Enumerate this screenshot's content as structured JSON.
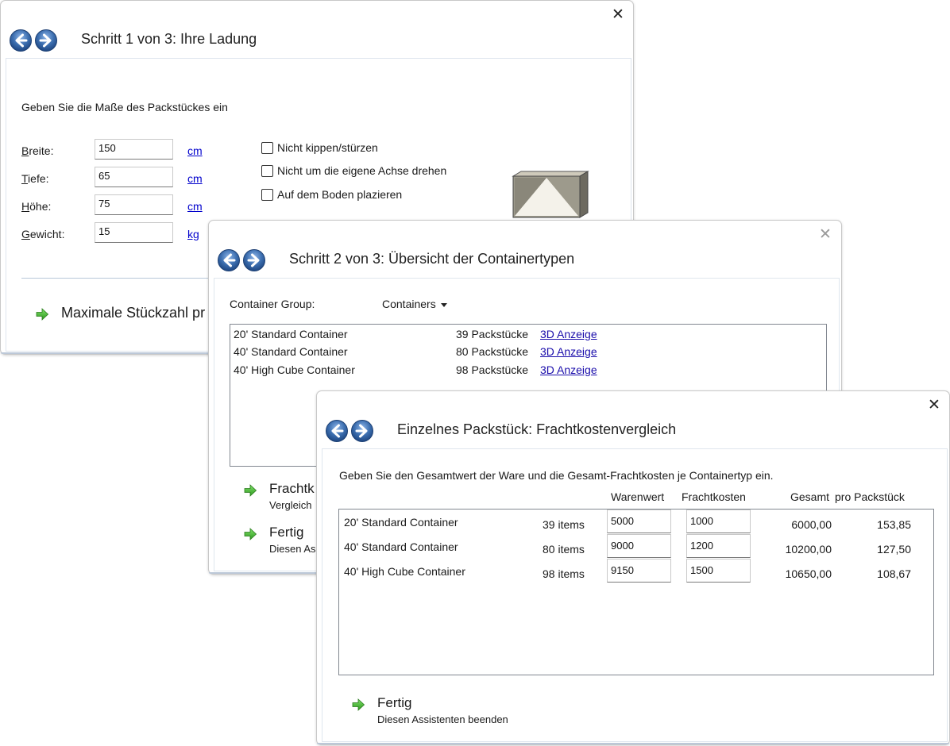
{
  "window1": {
    "title": "Schritt 1 von 3: Ihre Ladung",
    "instruction": "Geben Sie die Maße des Packstückes ein",
    "fields": [
      {
        "label": "Breite:",
        "value": "150",
        "unit": "cm"
      },
      {
        "label": "Tiefe:",
        "value": "65",
        "unit": "cm"
      },
      {
        "label": "Höhe:",
        "value": "75",
        "unit": "cm"
      },
      {
        "label": "Gewicht:",
        "value": "15",
        "unit": "kg"
      }
    ],
    "options": [
      "Nicht kippen/stürzen",
      "Nicht um die eigene Achse drehen",
      "Auf dem Boden plazieren"
    ],
    "action_label": "Maximale Stückzahl pr"
  },
  "window2": {
    "title": "Schritt 2 von 3: Übersicht der Containertypen",
    "group_label": "Container Group:",
    "group_value": "Containers",
    "rows": [
      {
        "name": "20' Standard Container",
        "count": "39 Packstücke",
        "link": "3D Anzeige"
      },
      {
        "name": "40' Standard Container",
        "count": "80 Packstücke",
        "link": "3D Anzeige"
      },
      {
        "name": "40' High Cube Container",
        "count": "98 Packstücke",
        "link": "3D Anzeige"
      }
    ],
    "actions": [
      {
        "title": "Frachtk",
        "sub": "Vergleich"
      },
      {
        "title": "Fertig",
        "sub": "Diesen As"
      }
    ]
  },
  "window3": {
    "title": "Einzelnes Packstück: Frachtkostenvergleich",
    "instruction": "Geben Sie den Gesamtwert der Ware und die Gesamt-Frachtkosten je Containertyp ein.",
    "headers": {
      "warenwert": "Warenwert",
      "frachtkosten": "Frachtkosten",
      "gesamt": "Gesamt",
      "pro": "pro Packstück"
    },
    "rows": [
      {
        "name": "20' Standard Container",
        "items": "39 items",
        "warenwert": "5000",
        "frachtkosten": "1000",
        "gesamt": "6000,00",
        "pro": "153,85"
      },
      {
        "name": "40' Standard Container",
        "items": "80 items",
        "warenwert": "9000",
        "frachtkosten": "1200",
        "gesamt": "10200,00",
        "pro": "127,50"
      },
      {
        "name": "40' High Cube Container",
        "items": "98 items",
        "warenwert": "9150",
        "frachtkosten": "1500",
        "gesamt": "10650,00",
        "pro": "108,67"
      }
    ],
    "finish_title": "Fertig",
    "finish_sub": "Diesen Assistenten beenden"
  },
  "colors": {
    "accent_link": "#1a0dab",
    "nav_blue": "#3d6fb0",
    "arrow_green": "#3aa82a"
  },
  "icons": {
    "close": "close-icon",
    "back": "back-arrow-icon",
    "forward": "forward-arrow-icon",
    "go": "green-arrow-icon",
    "box": "box-3d-icon"
  }
}
